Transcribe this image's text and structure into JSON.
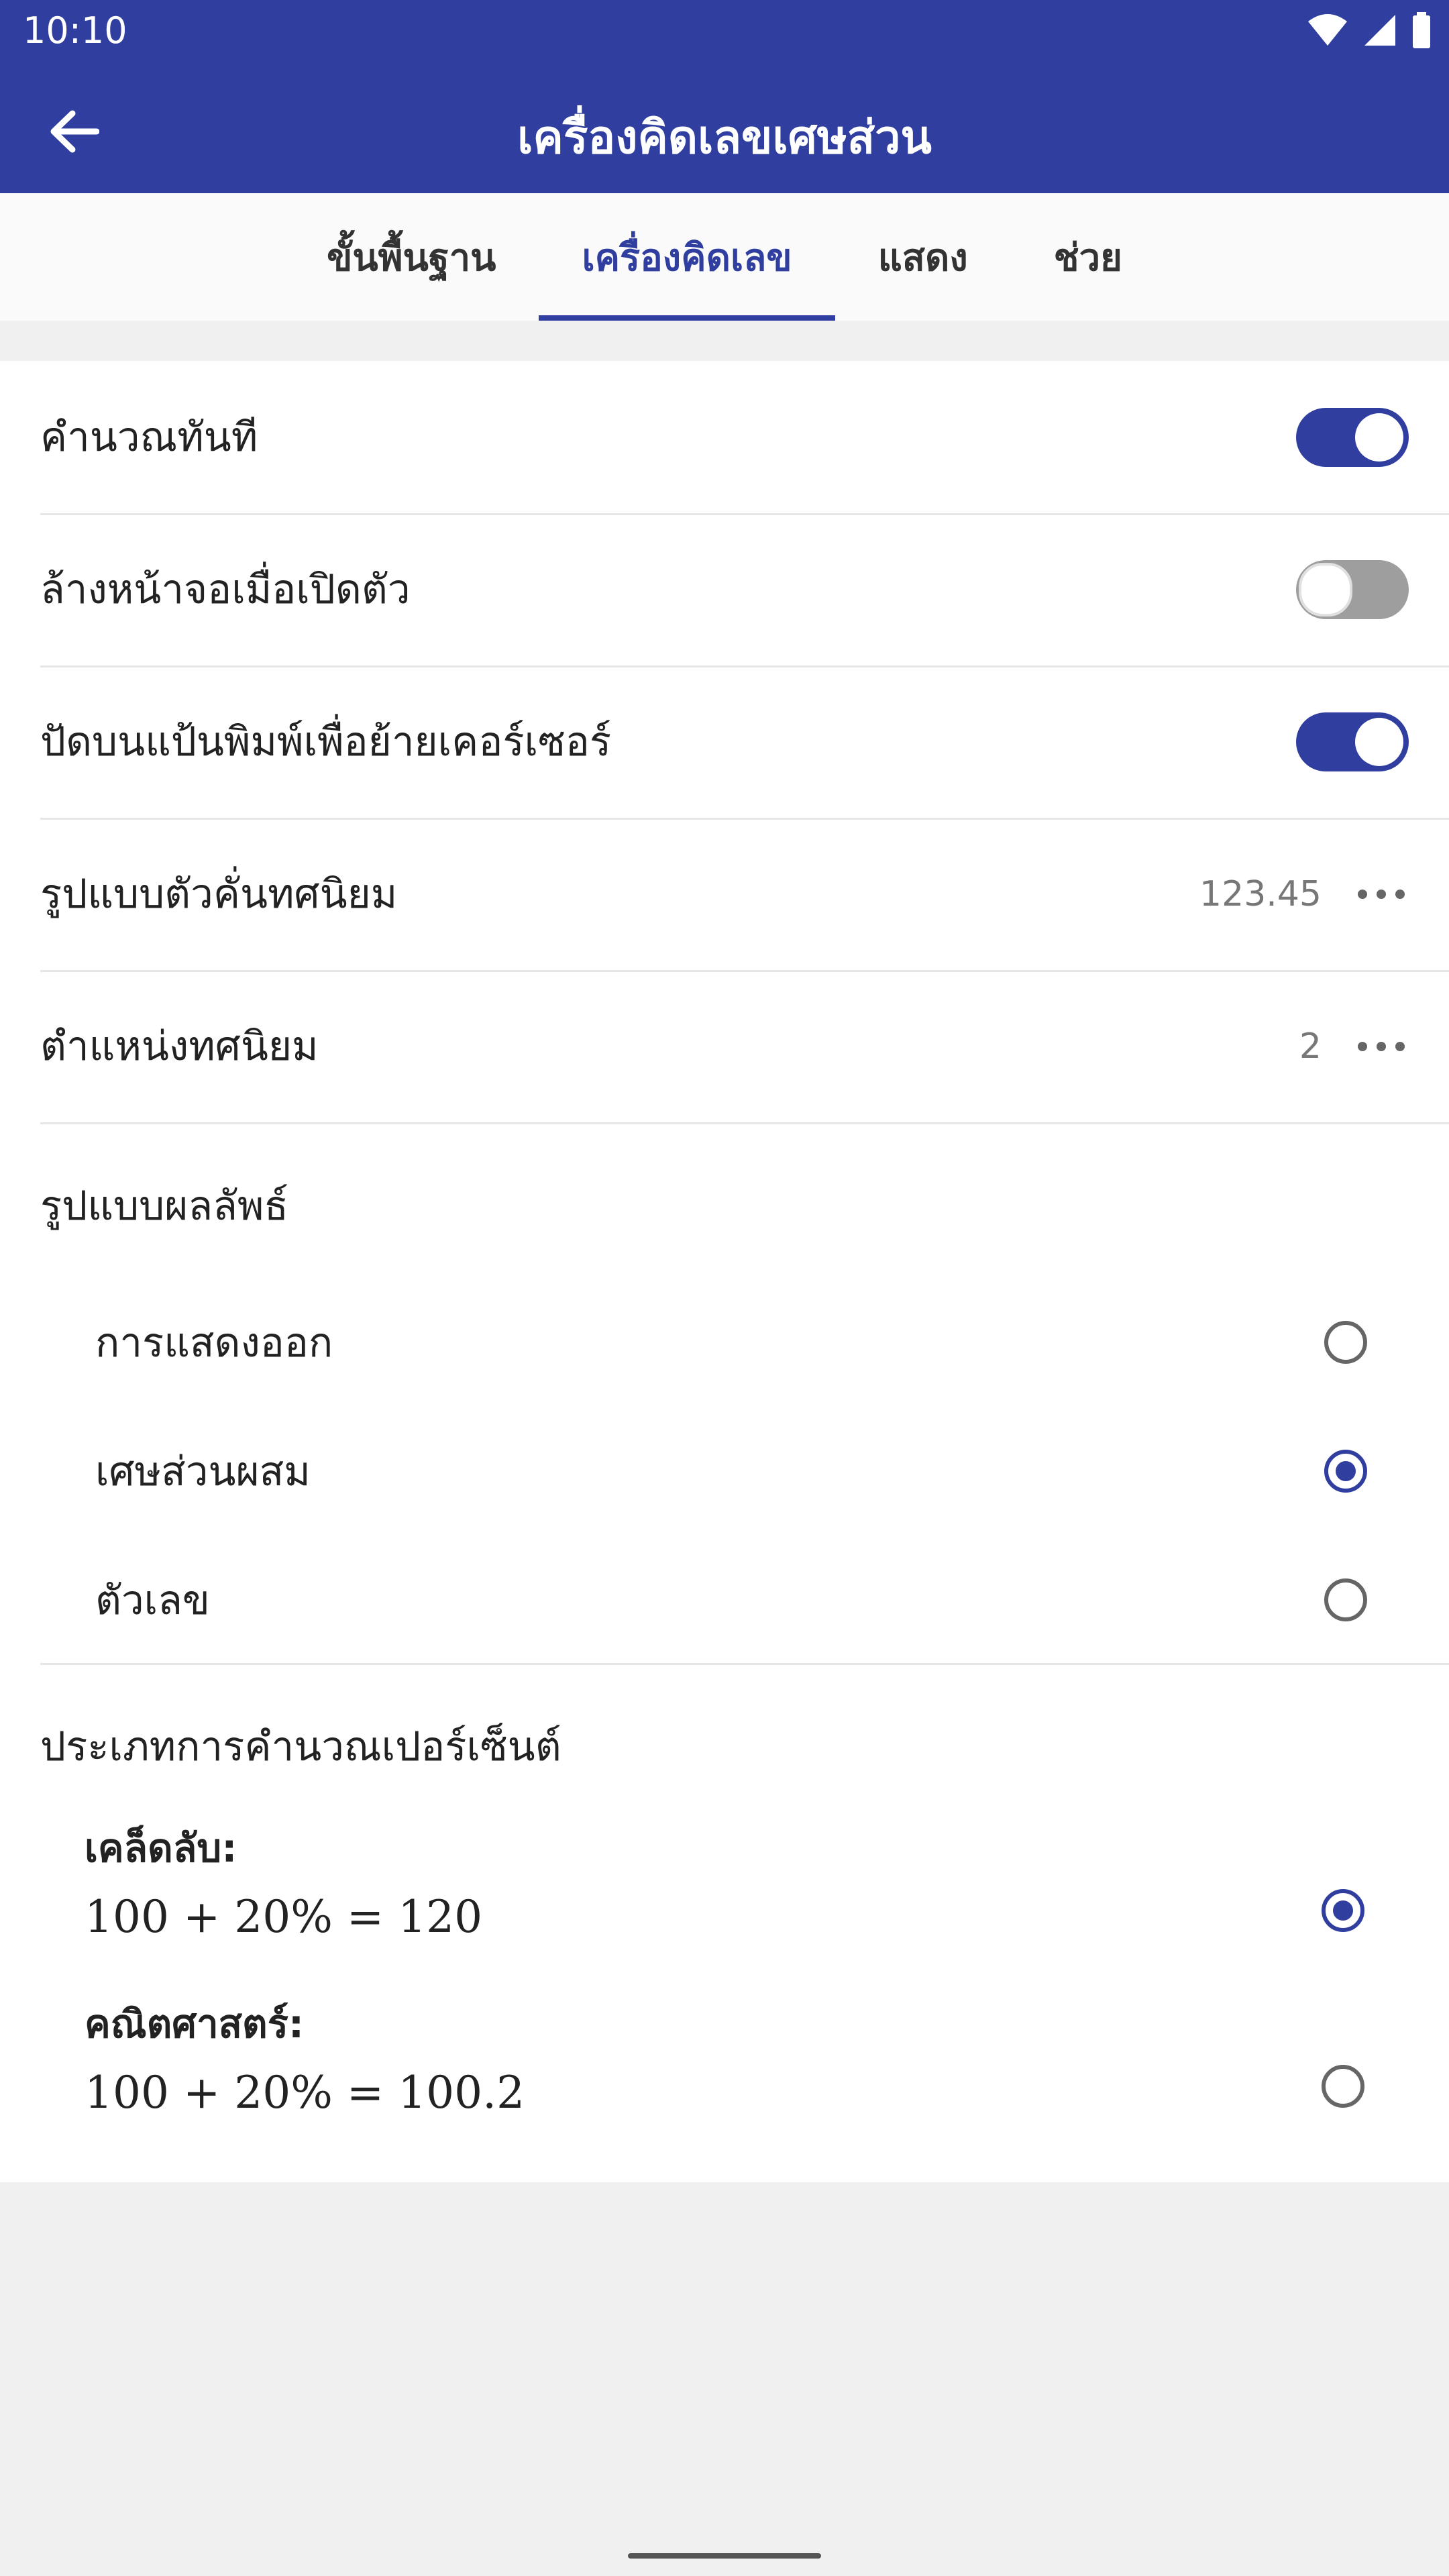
{
  "status_bar": {
    "time": "10:10"
  },
  "app_bar": {
    "title": "เครื่องคิดเลขเศษส่วน"
  },
  "tabs": [
    {
      "label": "ขั้นพื้นฐาน",
      "active": false
    },
    {
      "label": "เครื่องคิดเลข",
      "active": true
    },
    {
      "label": "แสดง",
      "active": false
    },
    {
      "label": "ช่วย",
      "active": false
    }
  ],
  "settings": {
    "instant_calc": {
      "label": "คำนวณทันที",
      "enabled": true
    },
    "clear_on_open": {
      "label": "ล้างหน้าจอเมื่อเปิดตัว",
      "enabled": false
    },
    "tap_keyboard_cursor": {
      "label": "ปัดบนแป้นพิมพ์เพื่อย้ายเคอร์เซอร์",
      "enabled": true
    },
    "decimal_format": {
      "label": "รูปแบบตัวคั่นทศนิยม",
      "value": "123.45"
    },
    "decimal_places": {
      "label": "ตำแหน่งทศนิยม",
      "value": "2"
    }
  },
  "result_format": {
    "title": "รูปแบบผลลัพธ์",
    "options": [
      {
        "label": "การแสดงออก",
        "selected": false
      },
      {
        "label": "เศษส่วนผสม",
        "selected": true
      },
      {
        "label": "ตัวเลข",
        "selected": false
      }
    ]
  },
  "percent_type": {
    "title": "ประเภทการคำนวณเปอร์เซ็นต์",
    "options": [
      {
        "name": "เคล็ดลับ:",
        "formula": "100 + 20% = 120",
        "selected": true
      },
      {
        "name": "คณิตศาสตร์:",
        "formula": "100 + 20% = 100.2",
        "selected": false
      }
    ]
  },
  "colors": {
    "primary": "#303f9f",
    "background": "#f0f0f0"
  }
}
